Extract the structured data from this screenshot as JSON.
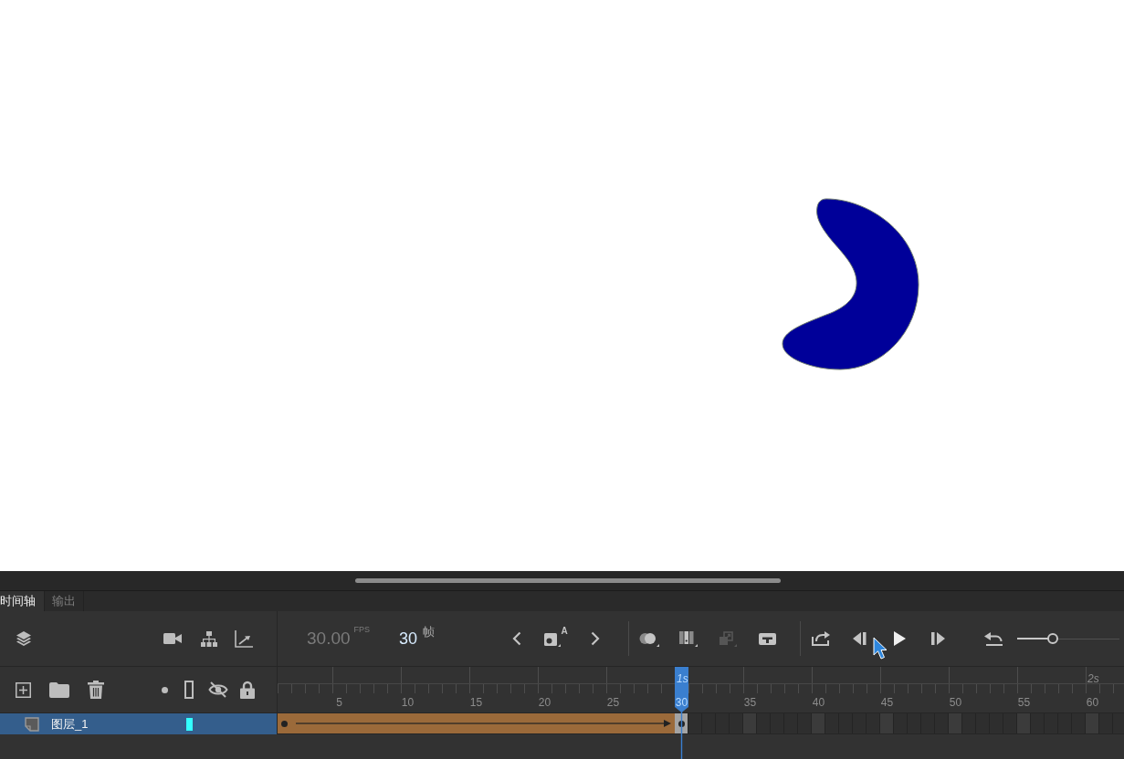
{
  "tabs": [
    {
      "label": "时间轴",
      "selected": true
    },
    {
      "label": "输出",
      "selected": false
    }
  ],
  "frame_rate": {
    "value": "30.00",
    "unit": "FPS"
  },
  "current_frame": {
    "value": "30",
    "unit": "帧"
  },
  "timeline_buttons": [
    {
      "kind": "previous",
      "disabled": false
    },
    {
      "kind": "keyframe",
      "label": "A",
      "disabled": false
    },
    {
      "kind": "next",
      "disabled": false
    },
    {
      "kind": "onion",
      "disabled": false
    },
    {
      "kind": "frames",
      "disabled": false
    },
    {
      "kind": "tween",
      "disabled": true
    },
    {
      "kind": "center",
      "disabled": false
    },
    {
      "kind": "loop",
      "disabled": false
    },
    {
      "kind": "stepback",
      "disabled": false
    },
    {
      "kind": "play",
      "disabled": false
    },
    {
      "kind": "stepforward",
      "disabled": false
    },
    {
      "kind": "rewind",
      "disabled": false
    }
  ],
  "zoom_slider": {
    "level": 0.35
  },
  "ruler": {
    "frame_labels": [
      "5",
      "10",
      "15",
      "20",
      "25",
      "30",
      "35",
      "40",
      "45",
      "50",
      "55",
      "60"
    ],
    "second_labels": [
      "1s",
      "2s"
    ]
  },
  "layers": [
    {
      "name": "图层_1",
      "selected": true,
      "color": "#33ffff",
      "frames": [
        {
          "kind": "keyframe",
          "selected": false
        },
        {
          "kind": "tween",
          "selected": false
        },
        {
          "kind": "tween",
          "selected": false
        },
        {
          "kind": "tween",
          "selected": false
        },
        {
          "kind": "tween",
          "selected": false
        },
        {
          "kind": "tween",
          "selected": false
        },
        {
          "kind": "tween",
          "selected": false
        },
        {
          "kind": "tween",
          "selected": false
        },
        {
          "kind": "tween",
          "selected": false
        },
        {
          "kind": "tween",
          "selected": false
        },
        {
          "kind": "tween",
          "selected": false
        },
        {
          "kind": "tween",
          "selected": false
        },
        {
          "kind": "tween",
          "selected": false
        },
        {
          "kind": "tween",
          "selected": false
        },
        {
          "kind": "tween",
          "selected": false
        },
        {
          "kind": "tween",
          "selected": false
        },
        {
          "kind": "tween",
          "selected": false
        },
        {
          "kind": "tween",
          "selected": false
        },
        {
          "kind": "tween",
          "selected": false
        },
        {
          "kind": "tween",
          "selected": false
        },
        {
          "kind": "tween",
          "selected": false
        },
        {
          "kind": "tween",
          "selected": false
        },
        {
          "kind": "tween",
          "selected": false
        },
        {
          "kind": "tween",
          "selected": false
        },
        {
          "kind": "tween",
          "selected": false
        },
        {
          "kind": "tween",
          "selected": false
        },
        {
          "kind": "tween",
          "selected": false
        },
        {
          "kind": "tween",
          "selected": false
        },
        {
          "kind": "tween",
          "selected": false
        },
        {
          "kind": "keyframe",
          "selected": true
        },
        {
          "kind": "empty",
          "selected": false
        },
        {
          "kind": "empty",
          "selected": false
        },
        {
          "kind": "empty",
          "selected": false
        },
        {
          "kind": "empty",
          "selected": false
        },
        {
          "kind": "empty",
          "selected": false
        },
        {
          "kind": "empty",
          "selected": false
        },
        {
          "kind": "empty",
          "selected": false
        },
        {
          "kind": "empty",
          "selected": false
        },
        {
          "kind": "empty",
          "selected": false
        },
        {
          "kind": "empty",
          "selected": false
        },
        {
          "kind": "empty",
          "selected": false
        },
        {
          "kind": "empty",
          "selected": false
        },
        {
          "kind": "empty",
          "selected": false
        },
        {
          "kind": "empty",
          "selected": false
        },
        {
          "kind": "empty",
          "selected": false
        },
        {
          "kind": "empty",
          "selected": false
        },
        {
          "kind": "empty",
          "selected": false
        },
        {
          "kind": "empty",
          "selected": false
        },
        {
          "kind": "empty",
          "selected": false
        },
        {
          "kind": "empty",
          "selected": false
        },
        {
          "kind": "empty",
          "selected": false
        },
        {
          "kind": "empty",
          "selected": false
        },
        {
          "kind": "empty",
          "selected": false
        },
        {
          "kind": "empty",
          "selected": false
        },
        {
          "kind": "empty",
          "selected": false
        },
        {
          "kind": "empty",
          "selected": false
        },
        {
          "kind": "empty",
          "selected": false
        },
        {
          "kind": "empty",
          "selected": false
        },
        {
          "kind": "empty",
          "selected": false
        },
        {
          "kind": "empty",
          "selected": false
        },
        {
          "kind": "empty",
          "selected": false
        },
        {
          "kind": "empty",
          "selected": false
        }
      ]
    }
  ]
}
